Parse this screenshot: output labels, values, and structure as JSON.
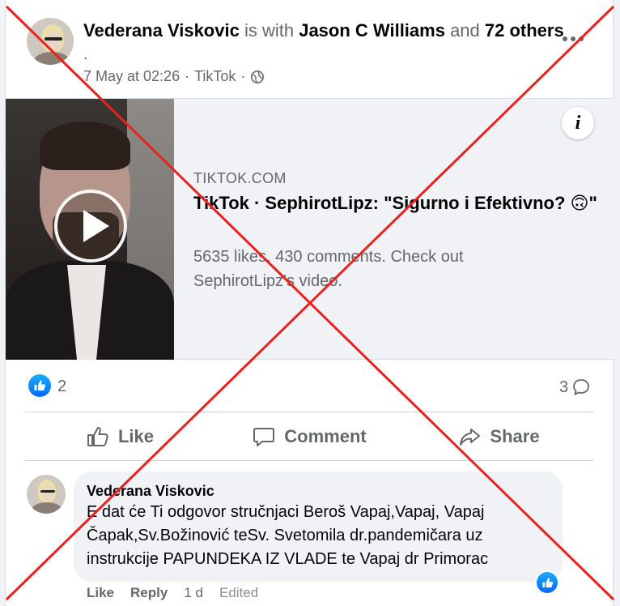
{
  "post": {
    "author": "Vederana Viskovic",
    "with_text": " is with ",
    "tagged": "Jason C Williams",
    "and_text": " and ",
    "others": "72 others",
    "trailing_dot": ".",
    "timestamp": "7 May at 02:26",
    "separator": "·",
    "source": "TikTok"
  },
  "link_preview": {
    "domain": "TIKTOK.COM",
    "title": "TikTok · SephirotLipz: \"Sigurno i Efektivno? 🙃\"",
    "description": "5635 likes, 430 comments. Check out SephirotLipz's video.",
    "info_label": "i"
  },
  "reactions": {
    "like_count": "2",
    "comment_count": "3"
  },
  "actions": {
    "like": "Like",
    "comment": "Comment",
    "share": "Share"
  },
  "comment": {
    "author": "Vederana Viskovic",
    "text": "E dat će Ti odgovor stručnjaci Beroš Vapaj,Vapaj, Vapaj Čapak,Sv.Božinović teSv. Svetomila dr.pandemičara uz instrukcije PAPUNDEKA IZ VLADE te Vapaj dr Primorac",
    "like_label": "Like",
    "reply_label": "Reply",
    "age": "1 d",
    "edited_label": "Edited"
  },
  "colors": {
    "facebook_blue": "#0866ff",
    "muted_text": "#65676b",
    "overlay_red": "#e8231f"
  }
}
